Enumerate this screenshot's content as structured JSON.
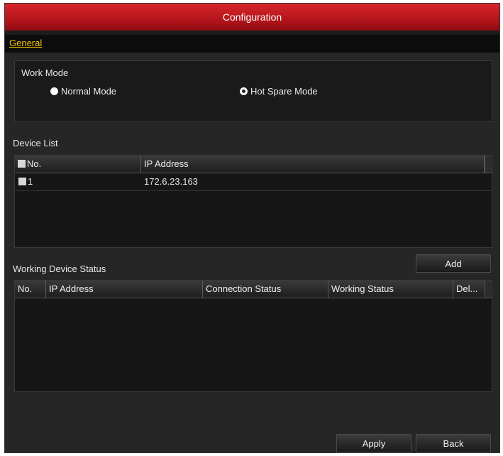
{
  "window": {
    "title": "Configuration"
  },
  "tabs": [
    {
      "label": "General",
      "active": true
    }
  ],
  "work_mode": {
    "title": "Work Mode",
    "options": [
      {
        "label": "Normal Mode",
        "selected": false
      },
      {
        "label": "Hot Spare Mode",
        "selected": true
      }
    ]
  },
  "device_list": {
    "title": "Device List",
    "columns": [
      "No.",
      "IP Address"
    ],
    "rows": [
      {
        "no": "1",
        "ip": "172.6.23.163"
      }
    ]
  },
  "add_label": "Add",
  "working_status": {
    "title": "Working Device Status",
    "columns": [
      "No.",
      "IP Address",
      "Connection Status",
      "Working Status",
      "Del..."
    ],
    "rows": []
  },
  "footer": {
    "apply_label": "Apply",
    "back_label": "Back"
  },
  "colors": {
    "title_bar": "#c41a1f",
    "tab_text": "#f5c400",
    "panel_bg": "#262626"
  }
}
